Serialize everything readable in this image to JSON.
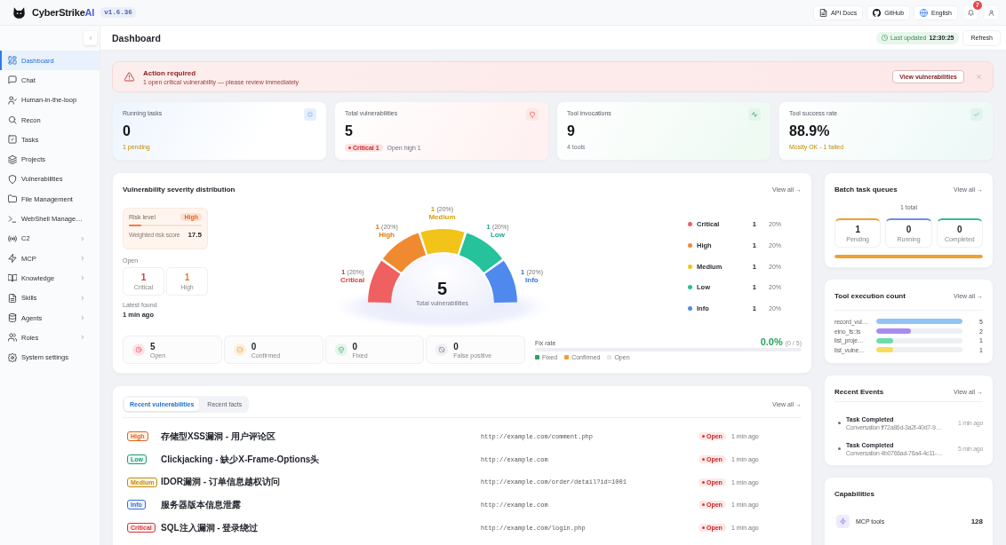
{
  "header": {
    "brand": {
      "name": "CyberStrike",
      "accent": "AI"
    },
    "version": "v1.6.36",
    "links": [
      {
        "kind": "docs",
        "label": "API Docs"
      },
      {
        "kind": "github",
        "label": "GitHub"
      },
      {
        "kind": "language",
        "label": "English"
      }
    ],
    "notifications": "7"
  },
  "sidebar": {
    "items": [
      {
        "label": "Dashboard",
        "selected": true,
        "expandable": false
      },
      {
        "label": "Chat",
        "selected": false,
        "expandable": false
      },
      {
        "label": "Human-in-the-loop",
        "selected": false,
        "expandable": false
      },
      {
        "label": "Recon",
        "selected": false,
        "expandable": false
      },
      {
        "label": "Tasks",
        "selected": false,
        "expandable": false
      },
      {
        "label": "Projects",
        "selected": false,
        "expandable": false
      },
      {
        "label": "Vulnerabilities",
        "selected": false,
        "expandable": false
      },
      {
        "label": "File Management",
        "selected": false,
        "expandable": false
      },
      {
        "label": "WebShell Manage…",
        "selected": false,
        "expandable": false
      },
      {
        "label": "C2",
        "selected": false,
        "expandable": true
      },
      {
        "label": "MCP",
        "selected": false,
        "expandable": true
      },
      {
        "label": "Knowledge",
        "selected": false,
        "expandable": true
      },
      {
        "label": "Skills",
        "selected": false,
        "expandable": true
      },
      {
        "label": "Agents",
        "selected": false,
        "expandable": true
      },
      {
        "label": "Roles",
        "selected": false,
        "expandable": true
      },
      {
        "label": "System settings",
        "selected": false,
        "expandable": false
      }
    ]
  },
  "page": {
    "title": "Dashboard",
    "last_updated": {
      "label": "Last updated",
      "time": "12:30:25"
    },
    "refresh": "Refresh"
  },
  "alert": {
    "title": "Action required",
    "message": "1 open critical vulnerability — please review immediately",
    "action": "View vulnerabilities"
  },
  "stat_cards": [
    {
      "kind": "running",
      "label": "Running tasks",
      "value": "0",
      "note": "1 pending",
      "warning": true
    },
    {
      "kind": "vulnerabilities",
      "label": "Total vulnerabilities",
      "value": "5",
      "badge": "Critical 1",
      "note": "Open high 1",
      "warning": false
    },
    {
      "kind": "invocations",
      "label": "Tool invocations",
      "value": "9",
      "note": "4 tools",
      "warning": false
    },
    {
      "kind": "success",
      "label": "Tool success rate",
      "value": "88.9%",
      "note": "Mostly OK - 1 failed",
      "warning": true
    }
  ],
  "severity_distribution": {
    "title": "Vulnerability severity distribution",
    "view_all": "View all →",
    "risk": {
      "label": "Risk level",
      "badge": "High",
      "level": 0.175,
      "score_label": "Weighted risk score",
      "score": "17.5"
    },
    "open_label": "Open",
    "open_counts": [
      {
        "count": "1",
        "label": "Critical",
        "color": "#d63b3b"
      },
      {
        "count": "1",
        "label": "High",
        "color": "#e5792a"
      }
    ],
    "latest_found_label": "Latest found",
    "latest_found": "1 min ago",
    "chart_data": {
      "type": "donut",
      "categories": [
        "Critical",
        "High",
        "Medium",
        "Low",
        "Info"
      ],
      "values": [
        20,
        20,
        20,
        20,
        20
      ]
    },
    "slice_labels": [
      {
        "count": "1",
        "share": "(20%)",
        "color": "#dc3b3b"
      },
      {
        "count": "1",
        "share": "(20%)",
        "color": "#e07a15"
      },
      {
        "count": "1",
        "share": "(20%)",
        "color": "#d4a20a"
      },
      {
        "count": "1",
        "share": "(20%)",
        "color": "#17a88a"
      },
      {
        "count": "1",
        "share": "(20%)",
        "color": "#3a72dc"
      }
    ],
    "total": "5",
    "total_label": "Total vulnerabilities",
    "legend": [
      {
        "name": "Critical",
        "count": "1",
        "share": "20%",
        "color": "#ef6060"
      },
      {
        "name": "High",
        "count": "1",
        "share": "20%",
        "color": "#f08a30"
      },
      {
        "name": "Medium",
        "count": "1",
        "share": "20%",
        "color": "#f2c318"
      },
      {
        "name": "Low",
        "count": "1",
        "share": "20%",
        "color": "#25c29c"
      },
      {
        "name": "Info",
        "count": "1",
        "share": "20%",
        "color": "#5089ee"
      }
    ],
    "status_counts": [
      {
        "kind": "open",
        "count": "5",
        "label": "Open"
      },
      {
        "kind": "confirmed",
        "count": "0",
        "label": "Confirmed"
      },
      {
        "kind": "fixed",
        "count": "0",
        "label": "Fixed"
      },
      {
        "kind": "false_positive",
        "count": "0",
        "label": "False positive"
      }
    ],
    "fix_rate": {
      "label": "Fix rate",
      "value": "0.0%",
      "detail": "(0 / 5)",
      "level": 0,
      "legend": [
        {
          "label": "Fixed",
          "color": "#2f9e5b"
        },
        {
          "label": "Confirmed",
          "color": "#f0a030"
        },
        {
          "label": "Open",
          "color": "#e6e8ec"
        }
      ]
    }
  },
  "recent": {
    "tabs": [
      {
        "label": "Recent vulnerabilities",
        "selected": true
      },
      {
        "label": "Recent facts",
        "selected": false
      }
    ],
    "view_all": "View all →",
    "rows": [
      {
        "severity": "High",
        "color": "#e5641c",
        "title": "存储型XSS漏洞 - 用户评论区",
        "url": "http://example.com/comment.php",
        "status": "Open",
        "time": "1 min ago"
      },
      {
        "severity": "Low",
        "color": "#1a9e74",
        "title": "Clickjacking - 缺少X-Frame-Options头",
        "url": "http://example.com",
        "status": "Open",
        "time": "1 min ago"
      },
      {
        "severity": "Medium",
        "color": "#c88a06",
        "title": "IDOR漏洞 - 订单信息越权访问",
        "url": "http://example.com/order/detail?id=1001",
        "status": "Open",
        "time": "1 min ago"
      },
      {
        "severity": "Info",
        "color": "#3a6fd8",
        "title": "服务器版本信息泄露",
        "url": "http://example.com",
        "status": "Open",
        "time": "1 min ago"
      },
      {
        "severity": "Critical",
        "color": "#d93636",
        "title": "SQL注入漏洞 - 登录绕过",
        "url": "http://example.com/login.php",
        "status": "Open",
        "time": "1 min ago"
      }
    ]
  },
  "batch_queues": {
    "title": "Batch task queues",
    "view_all": "View all →",
    "total": "1 total",
    "queues": [
      {
        "count": "1",
        "label": "Pending",
        "color": "#f0a030"
      },
      {
        "count": "0",
        "label": "Running",
        "color": "#6b8fe0"
      },
      {
        "count": "0",
        "label": "Completed",
        "color": "#3cb88e"
      }
    ],
    "level": 1
  },
  "tool_execution": {
    "title": "Tool execution count",
    "view_all": "View all →",
    "rows": [
      {
        "name": "record_vul…",
        "count": "5",
        "level": 1,
        "color": "#93c2f5"
      },
      {
        "name": "eino_fs::ls",
        "count": "2",
        "level": 0.4,
        "color": "#a98bf0"
      },
      {
        "name": "list_proje…",
        "count": "1",
        "level": 0.2,
        "color": "#6fdcae"
      },
      {
        "name": "list_vulne…",
        "count": "1",
        "level": 0.2,
        "color": "#f7dc5c"
      }
    ]
  },
  "recent_events": {
    "title": "Recent Events",
    "view_all": "View all →",
    "events": [
      {
        "title": "Task Completed",
        "detail": "Conversation ff72a86d-3a2f-40d7-9…",
        "time": "1 min ago"
      },
      {
        "title": "Task Completed",
        "detail": "Conversation 4b0766ad-76a4-4c11-…",
        "time": "5 min ago"
      }
    ]
  },
  "capabilities": {
    "title": "Capabilities",
    "items": [
      {
        "label": "MCP tools",
        "count": "128"
      }
    ]
  }
}
